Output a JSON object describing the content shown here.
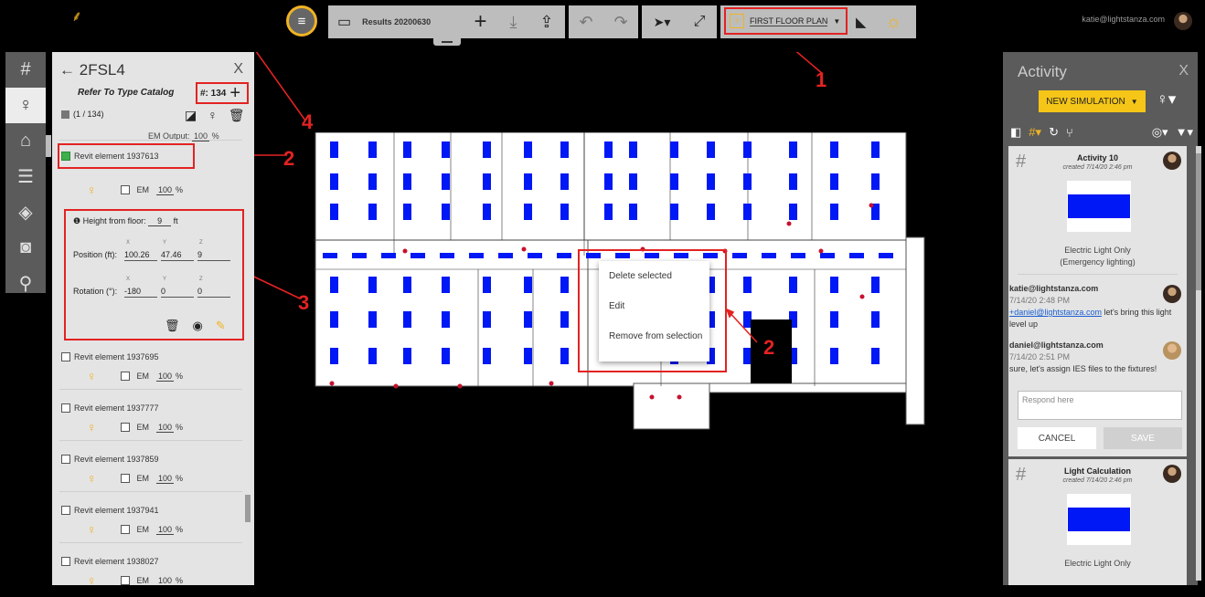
{
  "toolbar": {
    "file_name": "Results 20200630",
    "floor_plan": "FIRST FLOOR PLAN",
    "user_email": "katie@lightstanza.com"
  },
  "left_panel": {
    "title": "2FSL4",
    "close": "X",
    "type_label": "Refer To Type Catalog",
    "count": "#: 134",
    "selection": "(1 / 134)",
    "em_output_label": "EM Output:",
    "em_output_value": "100",
    "em_output_unit": "%",
    "selected_element": "Revit element 1937613",
    "em_label": "EM",
    "em_value": "100",
    "em_unit": "%",
    "height_label": "Height from floor:",
    "height_value": "9",
    "height_unit": "ft",
    "axis_x": "X",
    "axis_y": "Y",
    "axis_z": "Z",
    "position_label": "Position (ft):",
    "position": [
      "100.26",
      "47.46",
      "9"
    ],
    "rotation_label": "Rotation (°):",
    "rotation": [
      "-180",
      "0",
      "0"
    ],
    "elements": [
      {
        "label": "Revit element 1937695",
        "em": "EM",
        "value": "100",
        "unit": "%"
      },
      {
        "label": "Revit element 1937777",
        "em": "EM",
        "value": "100",
        "unit": "%"
      },
      {
        "label": "Revit element 1937859",
        "em": "EM",
        "value": "100",
        "unit": "%"
      },
      {
        "label": "Revit element 1937941",
        "em": "EM",
        "value": "100",
        "unit": "%"
      },
      {
        "label": "Revit element 1938027",
        "em": "EM",
        "value": "100",
        "unit": "%"
      }
    ]
  },
  "context_menu": {
    "items": [
      "Delete selected",
      "Edit",
      "Remove from selection"
    ]
  },
  "annotations": {
    "a1": "1",
    "a2": "2",
    "a3": "3",
    "a4": "4"
  },
  "activity": {
    "title": "Activity",
    "close": "X",
    "new_sim": "NEW SIMULATION",
    "card1": {
      "title": "Activity 10",
      "date": "created 7/14/20 2:46 pm",
      "caption1": "Electric Light Only",
      "caption2": "(Emergency lighting)"
    },
    "comment1": {
      "author": "katie@lightstanza.com",
      "time": "7/14/20 2:48 PM",
      "mention": "+daniel@lightstanza.com",
      "text": " let's bring this light level up"
    },
    "comment2": {
      "author": "daniel@lightstanza.com",
      "time": "7/14/20 2:51 PM",
      "text": "sure, let's assign IES files to the fixtures!"
    },
    "respond_placeholder": "Respond here",
    "cancel": "CANCEL",
    "save": "SAVE",
    "card2": {
      "title": "Light Calculation",
      "date": "created 7/14/20 2:46 pm",
      "caption": "Electric Light Only"
    }
  },
  "colors": {
    "accent": "#f0b323",
    "annotation": "#e32222",
    "fixture": "#0018f5",
    "toolbar": "#bdbdbd",
    "panel": "#e4e4e4"
  }
}
